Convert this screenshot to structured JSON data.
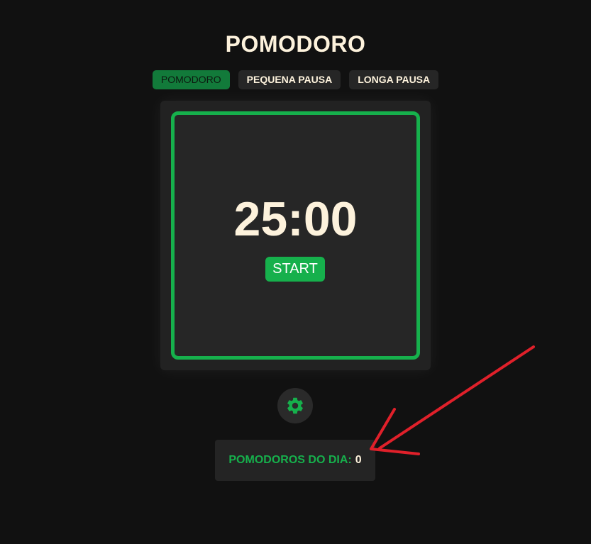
{
  "app": {
    "title": "POMODORO"
  },
  "tabs": [
    {
      "label": "POMODORO",
      "active": true
    },
    {
      "label": "PEQUENA PAUSA",
      "active": false
    },
    {
      "label": "LONGA PAUSA",
      "active": false
    }
  ],
  "timer": {
    "time": "25:00",
    "start_label": "START"
  },
  "settings": {
    "icon": "gear-icon"
  },
  "counter": {
    "label": "POMODOROS DO DIA:",
    "value": "0"
  },
  "annotation": {
    "icon": "red-arrow-annotation",
    "color": "#e0202a"
  },
  "colors": {
    "background": "#111111",
    "accent": "#16b04c",
    "text": "#fdf2dc",
    "panel": "#222222"
  }
}
